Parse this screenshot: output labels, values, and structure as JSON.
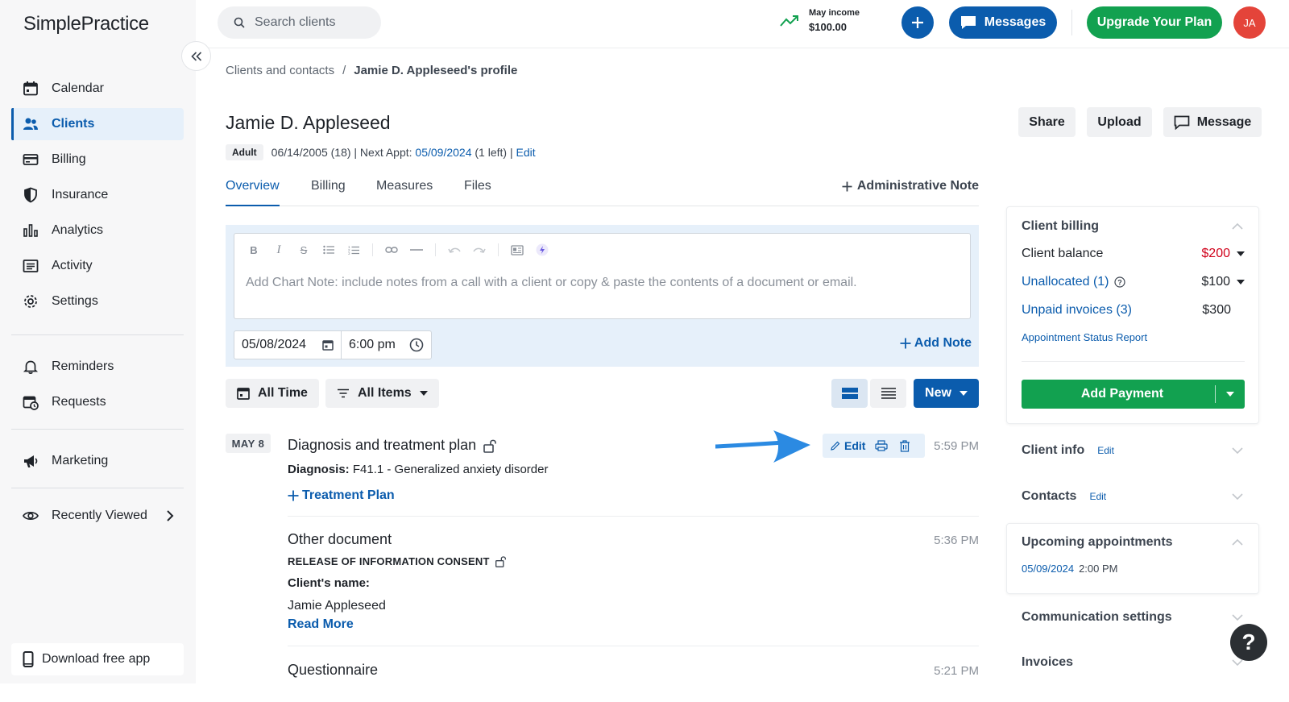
{
  "app": {
    "logo_text": "SimplePractice"
  },
  "sidebar": {
    "items": [
      {
        "label": "Calendar",
        "icon": "calendar-icon"
      },
      {
        "label": "Clients",
        "icon": "users-icon",
        "active": true
      },
      {
        "label": "Billing",
        "icon": "credit-card-icon"
      },
      {
        "label": "Insurance",
        "icon": "shield-icon"
      },
      {
        "label": "Analytics",
        "icon": "bar-chart-icon"
      },
      {
        "label": "Activity",
        "icon": "list-icon"
      },
      {
        "label": "Settings",
        "icon": "gear-icon"
      },
      {
        "label": "Reminders",
        "icon": "bell-icon"
      },
      {
        "label": "Requests",
        "icon": "calendar-clock-icon"
      },
      {
        "label": "Marketing",
        "icon": "megaphone-icon"
      },
      {
        "label": "Recently Viewed",
        "icon": "eye-icon"
      }
    ],
    "download_app": "Download free app"
  },
  "topbar": {
    "search_placeholder": "Search clients",
    "income_label": "May income",
    "income_value": "$100.00",
    "messages_label": "Messages",
    "upgrade_label": "Upgrade Your Plan",
    "avatar_initials": "JA"
  },
  "breadcrumb": {
    "parent": "Clients and contacts",
    "separator": "/",
    "current": "Jamie D. Appleseed's profile"
  },
  "client": {
    "name": "Jamie D. Appleseed",
    "badge": "Adult",
    "dob": "06/14/2005 (18) | Next Appt: ",
    "next_appt": "05/09/2024",
    "left": " (1 left) | ",
    "edit": "Edit"
  },
  "header_buttons": {
    "share": "Share",
    "upload": "Upload",
    "message": "Message"
  },
  "tabs": [
    "Overview",
    "Billing",
    "Measures",
    "Files"
  ],
  "admin_note": "Administrative Note",
  "note_editor": {
    "placeholder": "Add Chart Note: include notes from a call with a client or copy & paste the contents of a document or email.",
    "date": "05/08/2024",
    "time": "6:00 pm",
    "add_note": "Add Note"
  },
  "filters": {
    "time": "All Time",
    "items": "All Items",
    "new": "New"
  },
  "timeline": {
    "date_tag": "MAY 8",
    "entries": [
      {
        "title": "Diagnosis and treatment plan",
        "time": "5:59 PM",
        "diagnosis_label": "Diagnosis:",
        "diagnosis_value": "F41.1 - Generalized anxiety disorder",
        "link": "Treatment Plan",
        "edit": "Edit"
      },
      {
        "title": "Other document",
        "time": "5:36 PM",
        "caps": "RELEASE OF INFORMATION CONSENT",
        "field_label": "Client's name:",
        "field_value": "Jamie Appleseed",
        "read_more": "Read More"
      },
      {
        "title": "Questionnaire",
        "time": "5:21 PM"
      }
    ]
  },
  "right_panel": {
    "billing_title": "Client billing",
    "balance_label": "Client balance",
    "balance_value": "$200",
    "unallocated_label": "Unallocated (1)",
    "unallocated_value": "$100",
    "unpaid_label": "Unpaid invoices (3)",
    "unpaid_value": "$300",
    "status_report": "Appointment Status Report",
    "add_payment": "Add Payment",
    "client_info": "Client info",
    "contacts": "Contacts",
    "edit": "Edit",
    "upcoming": "Upcoming appointments",
    "upcoming_date": "05/09/2024",
    "upcoming_time": "2:00 PM",
    "communication": "Communication settings",
    "invoices": "Invoices"
  },
  "help": "?",
  "colors": {
    "primary": "#0b5cad",
    "green": "#12a150",
    "red": "#d0021b",
    "avatar": "#e4443a"
  }
}
